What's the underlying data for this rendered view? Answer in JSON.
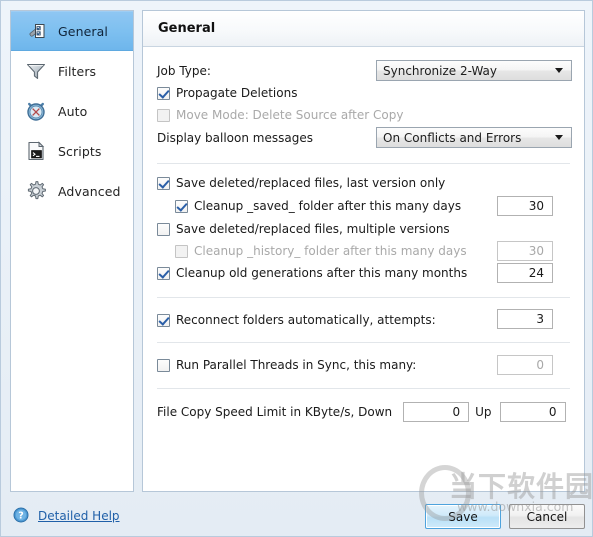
{
  "window": {
    "title": "General"
  },
  "sidebar": {
    "items": [
      {
        "label": "General",
        "icon": "wrench-icon",
        "selected": true
      },
      {
        "label": "Filters",
        "icon": "funnel-icon",
        "selected": false
      },
      {
        "label": "Auto",
        "icon": "clock-icon",
        "selected": false
      },
      {
        "label": "Scripts",
        "icon": "script-icon",
        "selected": false
      },
      {
        "label": "Advanced",
        "icon": "gear-icon",
        "selected": false
      }
    ]
  },
  "panel": {
    "header_title": "General",
    "job_type": {
      "label": "Job Type:",
      "value": "Synchronize 2-Way"
    },
    "propagate_deletions": {
      "label": "Propagate Deletions",
      "checked": true,
      "enabled": true
    },
    "move_mode": {
      "label": "Move Mode: Delete Source after Copy",
      "checked": false,
      "enabled": false
    },
    "balloon": {
      "label": "Display balloon messages",
      "value": "On Conflicts and Errors"
    },
    "save_last_version": {
      "label": "Save deleted/replaced files, last version only",
      "checked": true,
      "enabled": true
    },
    "cleanup_saved": {
      "label": "Cleanup _saved_ folder after this many days",
      "checked": true,
      "enabled": true,
      "value": "30"
    },
    "save_multiple_versions": {
      "label": "Save deleted/replaced files, multiple versions",
      "checked": false,
      "enabled": true
    },
    "cleanup_history": {
      "label": "Cleanup _history_ folder after this many days",
      "checked": false,
      "enabled": false,
      "value": "30"
    },
    "cleanup_generations": {
      "label": "Cleanup old generations after this many months",
      "checked": true,
      "enabled": true,
      "value": "24"
    },
    "reconnect": {
      "label": "Reconnect folders automatically, attempts:",
      "checked": true,
      "enabled": true,
      "value": "3"
    },
    "parallel_threads": {
      "label": "Run Parallel Threads in Sync, this many:",
      "checked": false,
      "enabled": false,
      "value": "0"
    },
    "speed_limit": {
      "label": "File Copy Speed Limit in KByte/s, Down",
      "down_value": "0",
      "up_label": "Up",
      "up_value": "0"
    }
  },
  "footer": {
    "help_label": "Detailed Help",
    "help_icon": "question-mark-icon",
    "save_label": "Save",
    "cancel_label": "Cancel"
  },
  "watermark": {
    "brand": "当下软件园",
    "url": "www.downxia.com"
  },
  "colors": {
    "selection_blue": "#7ec0f0",
    "link_blue": "#1f5fa8",
    "panel_border": "#b6c7d8",
    "window_bg": "#e9f0f7",
    "save_accent": "#4ea3dd"
  }
}
